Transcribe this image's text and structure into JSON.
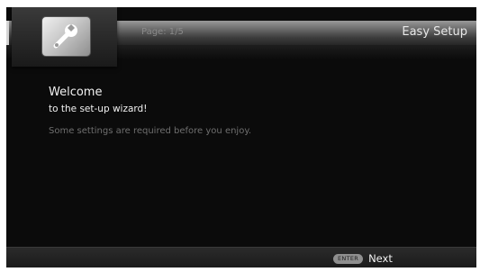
{
  "header": {
    "page_indicator": "Page: 1/5",
    "title": "Easy Setup",
    "icon": "wrench-icon"
  },
  "main": {
    "title": "Welcome",
    "subtitle": "to the set-up wizard!",
    "info": "Some settings are required before you enjoy."
  },
  "footer": {
    "enter_key": "ENTER",
    "next_label": "Next"
  },
  "colors": {
    "background": "#0b0b0b",
    "header_bar": "#6a6a6a",
    "text_primary": "#f2f2f2",
    "text_muted": "#6f6f6f"
  }
}
